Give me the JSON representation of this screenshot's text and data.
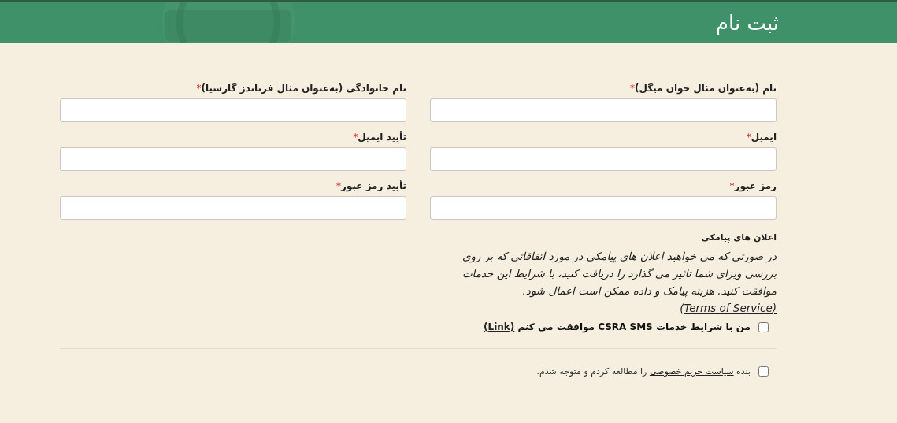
{
  "header": {
    "title": "ثبت نام"
  },
  "fields": [
    {
      "label": "نام (به‌عنوان مثال خوان میگل)",
      "marker": "*"
    },
    {
      "label": "نام خانوادگی (به‌عنوان مثال فرناندز گارسیا)",
      "marker": "*"
    },
    {
      "label": "ایمیل",
      "marker": "*"
    },
    {
      "label": "تأیید ایمیل",
      "marker": "*"
    },
    {
      "label": "رمز عبور",
      "marker": "*"
    },
    {
      "label": "تأیید رمز عبور",
      "marker": "*"
    }
  ],
  "sms": {
    "title": "اعلان های پیامکی",
    "text": "در صورتی که می خواهید اعلان های پیامکی در مورد اتفاقاتی که بر روی بررسی ویزای شما تاثیر می گذارد را دریافت کنید، با شرایط این خدمات موافقت کنید. هزینه پیامک و داده ممکن است اعمال شود.",
    "link": "(Terms of Service)",
    "consent": {
      "before": "من با شرایط خدمات CSRA SMS موافقت می کنم",
      "link": "(Link)",
      "checked": false
    }
  },
  "privacy": {
    "before": "بنده",
    "link": "سیاست حریم خصوصی",
    "after": "را مطالعه کردم و متوجه شدم.",
    "checked": false
  }
}
